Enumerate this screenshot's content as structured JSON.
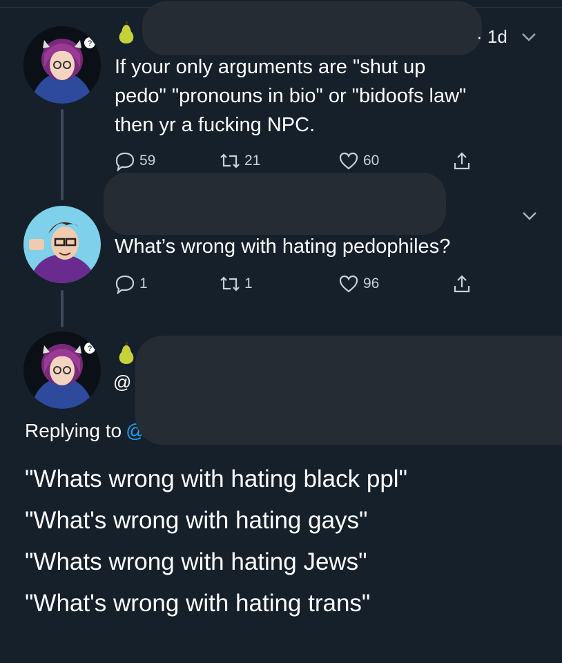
{
  "tweet1": {
    "time": "1d",
    "text_lines": [
      "If your only arguments are \"shut up",
      "pedo\" \"pronouns in bio\" or \"bidoofs law\"",
      "then yr a fucking NPC."
    ],
    "replies": "59",
    "retweets": "21",
    "likes": "60"
  },
  "tweet2": {
    "text": "What’s wrong with hating pedophiles?",
    "replies": "1",
    "retweets": "1",
    "likes": "96"
  },
  "tweet3": {
    "handle_prefix": "@",
    "replying_to": "Replying to",
    "replying_at": "@",
    "lines": [
      "\"Whats wrong with hating black ppl\"",
      "\"What's wrong with hating gays\"",
      "\"Whats wrong with hating Jews\"",
      "\"What's wrong with hating trans\""
    ]
  },
  "icons": {
    "reply": "reply-icon",
    "retweet": "retweet-icon",
    "like": "heart-icon",
    "share": "share-icon",
    "more": "chevron-down-icon",
    "emoji": "pear-emoji"
  },
  "colors": {
    "background": "#15202b",
    "text": "#ffffff",
    "muted": "#c8d1da",
    "redaction": "#262c33"
  }
}
